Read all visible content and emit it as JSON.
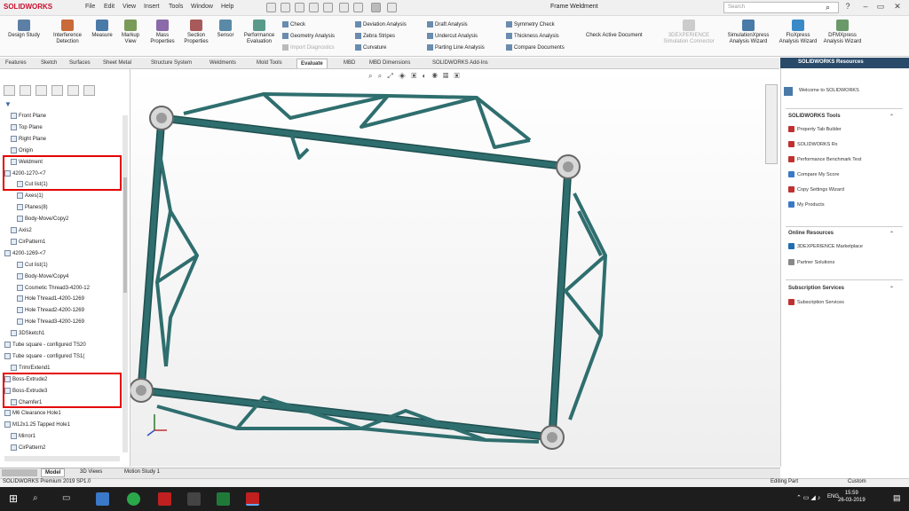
{
  "titlebar": {
    "logo": "SOLIDWORKS",
    "menus": [
      "File",
      "Edit",
      "View",
      "Insert",
      "Tools",
      "Window",
      "Help"
    ],
    "document_title": "Frame Weldment",
    "search_placeholder": "Search"
  },
  "ribbon": {
    "big_buttons": [
      "Design Study",
      "Interference Detection",
      "Measure",
      "Markup View",
      "Mass Properties",
      "Section Properties",
      "Sensor",
      "Performance Evaluation"
    ],
    "small_col1": [
      "Check",
      "Geometry Analysis",
      "Import Diagnostics"
    ],
    "small_col2": [
      "Deviation Analysis",
      "Zebra Stripes",
      "Curvature"
    ],
    "small_col3": [
      "Draft Analysis",
      "Undercut Analysis",
      "Parting Line Analysis"
    ],
    "small_col4": [
      "Symmetry Check",
      "Thickness Analysis",
      "Compare Documents"
    ],
    "check_active": "Check Active Document",
    "right_buttons": [
      "3DEXPERIENCE Simulation Connector",
      "SimulationXpress Analysis Wizard",
      "FloXpress Analysis Wizard",
      "DFMXpress Analysis Wizard"
    ]
  },
  "tabs": [
    "Features",
    "Sketch",
    "Surfaces",
    "Sheet Metal",
    "Structure System",
    "Weldments",
    "Mold Tools",
    "Evaluate",
    "MBD",
    "MBD Dimensions",
    "SOLIDWORKS Add-Ins"
  ],
  "active_tab": "Evaluate",
  "tree": [
    {
      "label": "Front Plane",
      "indent": 1
    },
    {
      "label": "Top Plane",
      "indent": 1
    },
    {
      "label": "Right Plane",
      "indent": 1
    },
    {
      "label": "Origin",
      "indent": 1
    },
    {
      "label": "Weldment",
      "indent": 1
    },
    {
      "label": "4200-1270-<7",
      "indent": 0
    },
    {
      "label": "Cut list(1)",
      "indent": 2
    },
    {
      "label": "Axes(1)",
      "indent": 2
    },
    {
      "label": "Planes(8)",
      "indent": 2
    },
    {
      "label": "Body-Move/Copy2",
      "indent": 2
    },
    {
      "label": "Axis2",
      "indent": 1
    },
    {
      "label": "CirPattern1",
      "indent": 1
    },
    {
      "label": "4200-1269-<7",
      "indent": 0
    },
    {
      "label": "Cut list(1)",
      "indent": 2
    },
    {
      "label": "Body-Move/Copy4",
      "indent": 2
    },
    {
      "label": "Cosmetic Thread3-4200-12",
      "indent": 2
    },
    {
      "label": "Hole Thread1-4200-1269",
      "indent": 2
    },
    {
      "label": "Hole Thread2-4200-1269",
      "indent": 2
    },
    {
      "label": "Hole Thread3-4200-1269",
      "indent": 2
    },
    {
      "label": "3DSketch1",
      "indent": 1
    },
    {
      "label": "Tube square - configured TS20",
      "indent": 0
    },
    {
      "label": "Tube square - configured TS1(",
      "indent": 0
    },
    {
      "label": "Trim/Extend1",
      "indent": 1
    },
    {
      "label": "Boss-Extrude2",
      "indent": 0
    },
    {
      "label": "Boss-Extrude3",
      "indent": 0
    },
    {
      "label": "Chamfer1",
      "indent": 1
    },
    {
      "label": "M6 Clearance Hole1",
      "indent": 0
    },
    {
      "label": "M12x1.25 Tapped Hole1",
      "indent": 0
    },
    {
      "label": "Mirror1",
      "indent": 1
    },
    {
      "label": "CirPattern2",
      "indent": 1
    }
  ],
  "right_panel": {
    "title": "SOLIDWORKS Resources",
    "welcome": "Welcome to SOLIDWORKS",
    "tools_title": "SOLIDWORKS Tools",
    "tools": [
      "Property Tab Builder",
      "SOLIDWORKS Rx",
      "Performance Benchmark Test",
      "Compare My Score",
      "Copy Settings Wizard",
      "My Products"
    ],
    "online_title": "Online Resources",
    "online": [
      "3DEXPERIENCE Marketplace",
      "Partner Solutions"
    ],
    "sub_title": "Subscription Services",
    "sub": [
      "Subscription Services"
    ]
  },
  "bottom_tabs": [
    "Model",
    "3D Views",
    "Motion Study 1"
  ],
  "active_bottom_tab": "Model",
  "status": {
    "left": "SOLIDWORKS Premium 2019 SP1.0",
    "editing": "Editing Part",
    "custom": "Custom"
  },
  "clock": {
    "time": "15:59",
    "date": "26-03-2019",
    "lang": "ENG"
  },
  "colors": {
    "frame": "#2f6e6e",
    "highlight": "#e60000",
    "resource_header": "#2a4a6a"
  }
}
